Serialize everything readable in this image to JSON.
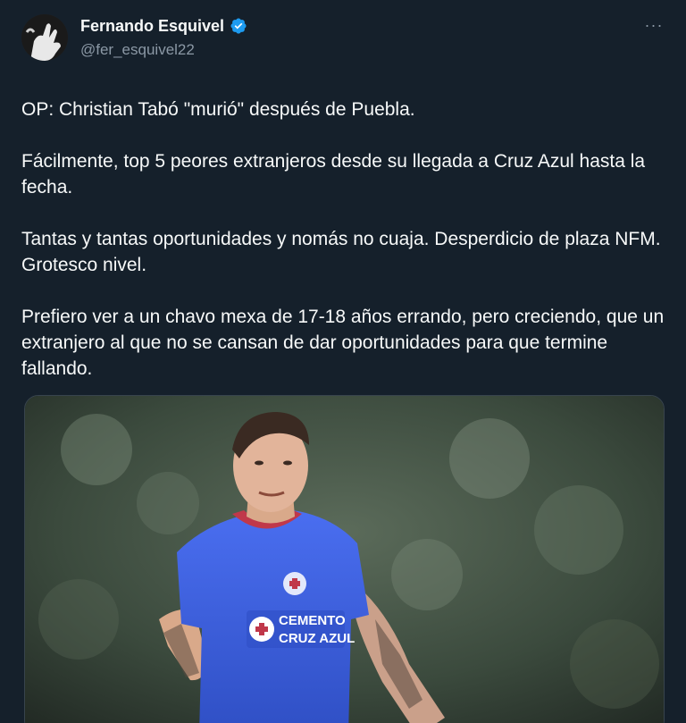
{
  "user": {
    "display_name": "Fernando Esquivel",
    "handle": "@fer_esquivel22",
    "verified": true
  },
  "more_menu": "···",
  "tweet_paragraphs": [
    "OP: Christian Tabó \"murió\" después de Puebla.",
    "Fácilmente, top 5 peores extranjeros desde su llegada a Cruz Azul hasta la fecha.",
    "Tantas y tantas oportunidades y nomás no cuaja. Desperdicio de plaza NFM. Grotesco nivel.",
    "Prefiero ver a un chavo mexa de 17-18 años errando, pero creciendo, que un extranjero al que no se cansan de dar oportunidades para que termine fallando."
  ],
  "media": {
    "jersey_text_line1": "CEMENTO",
    "jersey_text_line2": "CRUZ AZUL"
  },
  "colors": {
    "background": "#15202b",
    "text": "#f7f9f9",
    "secondary_text": "#8b98a5",
    "verified_blue": "#1d9bf0",
    "jersey_blue": "#3a5fd9"
  },
  "icons": {
    "verified": "verified-badge-icon",
    "more": "more-horizontal-icon"
  }
}
